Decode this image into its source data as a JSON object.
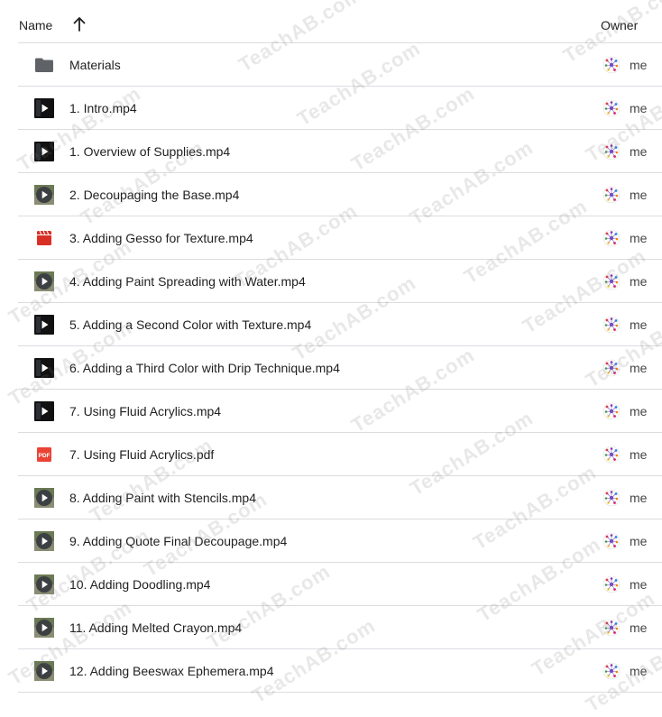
{
  "header": {
    "name_label": "Name",
    "owner_label": "Owner",
    "sort_icon": "arrow-up-icon"
  },
  "watermark": "TeachAB.com",
  "files": [
    {
      "name": "Materials",
      "type": "folder",
      "owner": "me"
    },
    {
      "name": "1. Intro.mp4",
      "type": "video-dark",
      "owner": "me"
    },
    {
      "name": "1. Overview of Supplies.mp4",
      "type": "video-dark",
      "owner": "me"
    },
    {
      "name": "2. Decoupaging the Base.mp4",
      "type": "video-circle",
      "owner": "me"
    },
    {
      "name": "3. Adding Gesso for Texture.mp4",
      "type": "video-red",
      "owner": "me"
    },
    {
      "name": "4. Adding Paint Spreading with Water.mp4",
      "type": "video-circle",
      "owner": "me"
    },
    {
      "name": "5. Adding a Second Color with Texture.mp4",
      "type": "video-dark",
      "owner": "me"
    },
    {
      "name": "6. Adding a Third Color with Drip Technique.mp4",
      "type": "video-dark",
      "owner": "me"
    },
    {
      "name": "7. Using Fluid Acrylics.mp4",
      "type": "video-dark",
      "owner": "me"
    },
    {
      "name": "7. Using Fluid Acrylics.pdf",
      "type": "pdf",
      "owner": "me"
    },
    {
      "name": "8. Adding Paint with Stencils.mp4",
      "type": "video-circle",
      "owner": "me"
    },
    {
      "name": "9. Adding Quote Final Decoupage.mp4",
      "type": "video-circle",
      "owner": "me"
    },
    {
      "name": "10. Adding Doodling.mp4",
      "type": "video-circle",
      "owner": "me"
    },
    {
      "name": "11. Adding Melted Crayon.mp4",
      "type": "video-circle",
      "owner": "me"
    },
    {
      "name": "12. Adding Beeswax Ephemera.mp4",
      "type": "video-circle",
      "owner": "me"
    }
  ],
  "colors": {
    "folder": "#5f6368",
    "pdf": "#ea4335",
    "video_red": "#d93025",
    "divider": "#dadce0"
  }
}
